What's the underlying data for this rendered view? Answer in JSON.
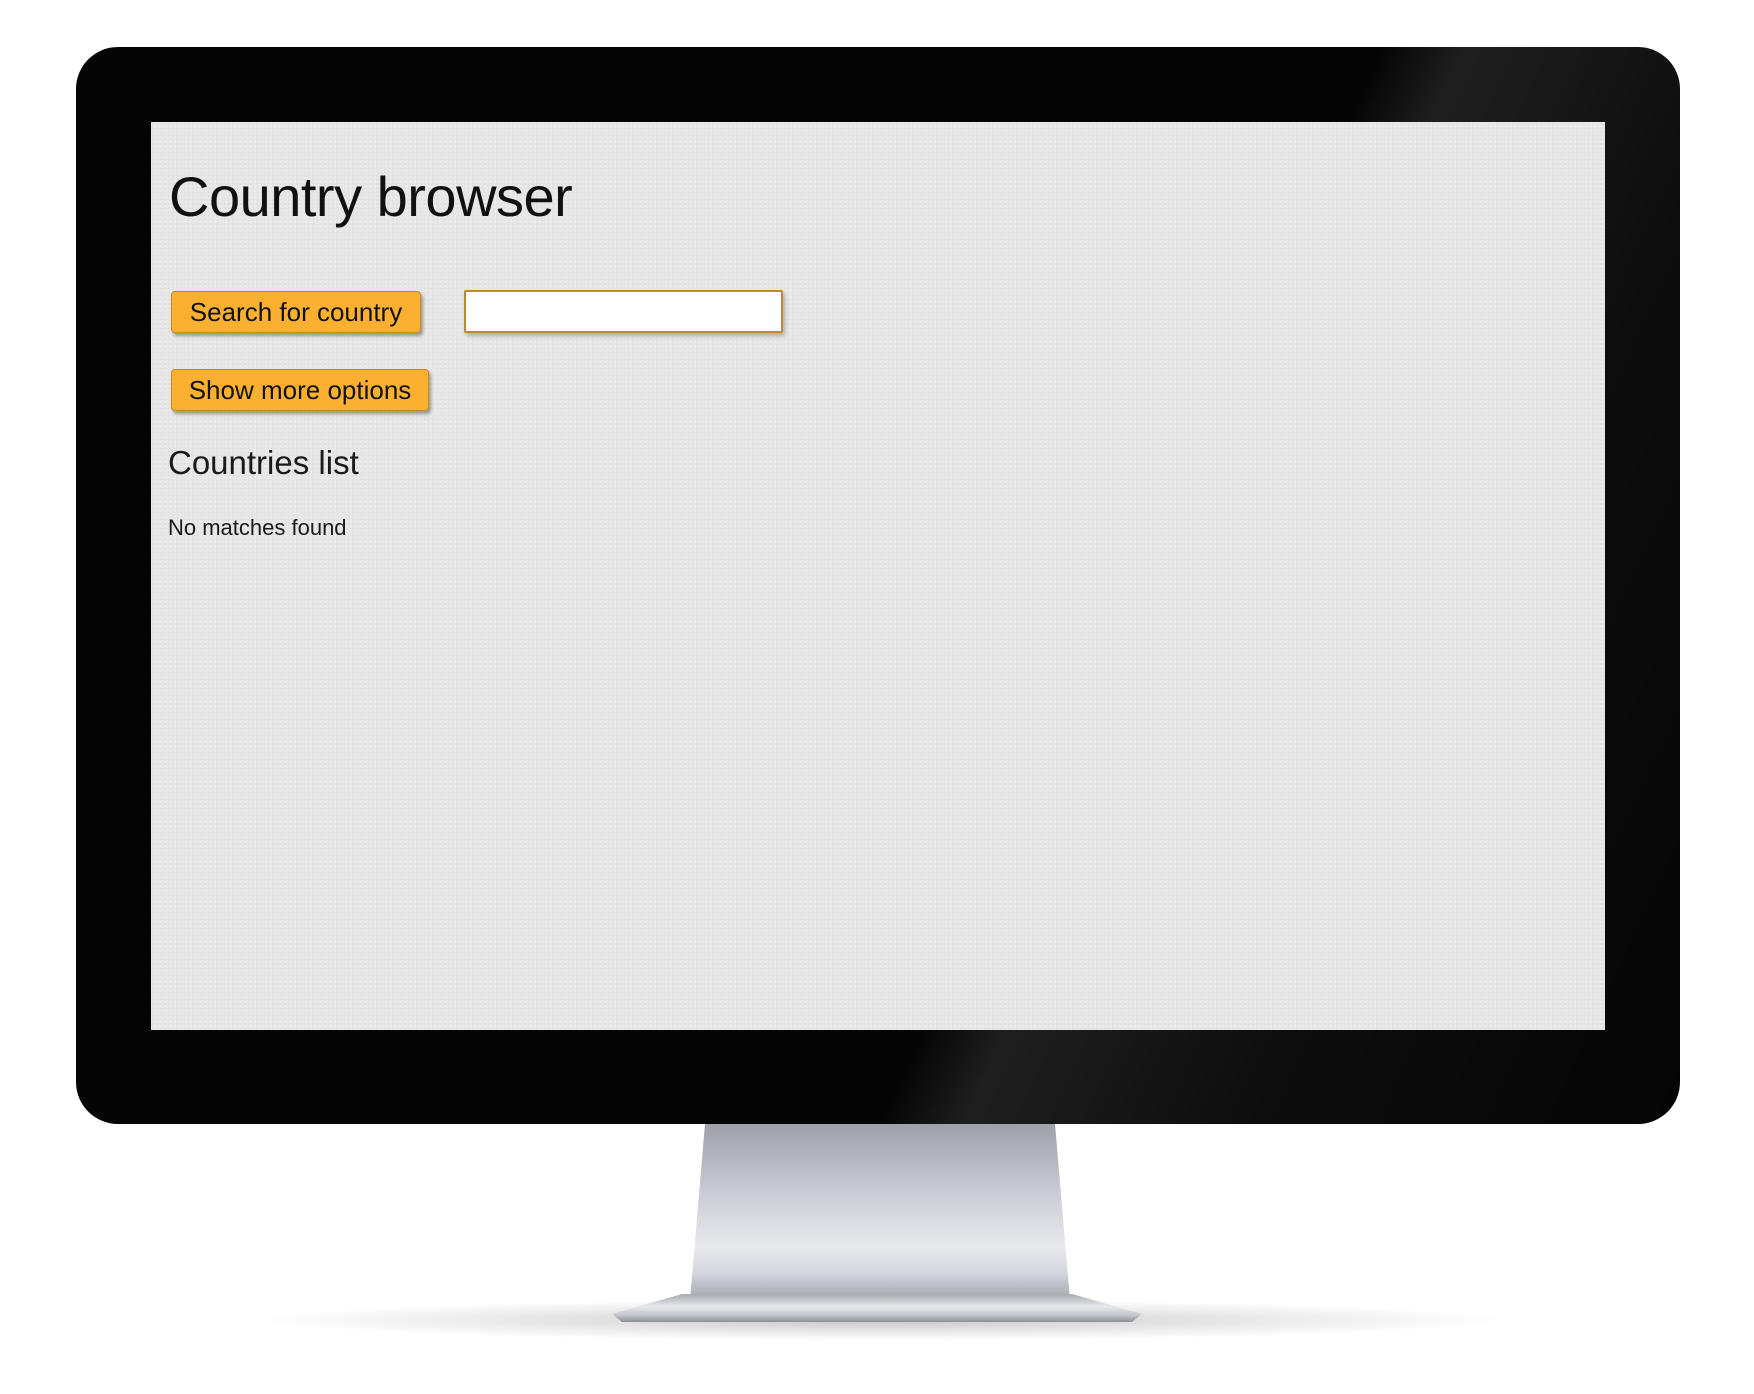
{
  "app": {
    "title": "Country browser"
  },
  "search": {
    "button_label": "Search for country",
    "input_value": "",
    "input_placeholder": ""
  },
  "options": {
    "button_label": "Show more options"
  },
  "countries": {
    "heading": "Countries list",
    "status": "No matches found",
    "items": []
  },
  "colors": {
    "button_bg": "#fbb12f",
    "button_border": "#c58a22",
    "screen_bg": "#e7e7e7",
    "bezel": "#050505",
    "input_border": "#c08a2c"
  },
  "icons": {
    "camera": "webcam-icon"
  }
}
